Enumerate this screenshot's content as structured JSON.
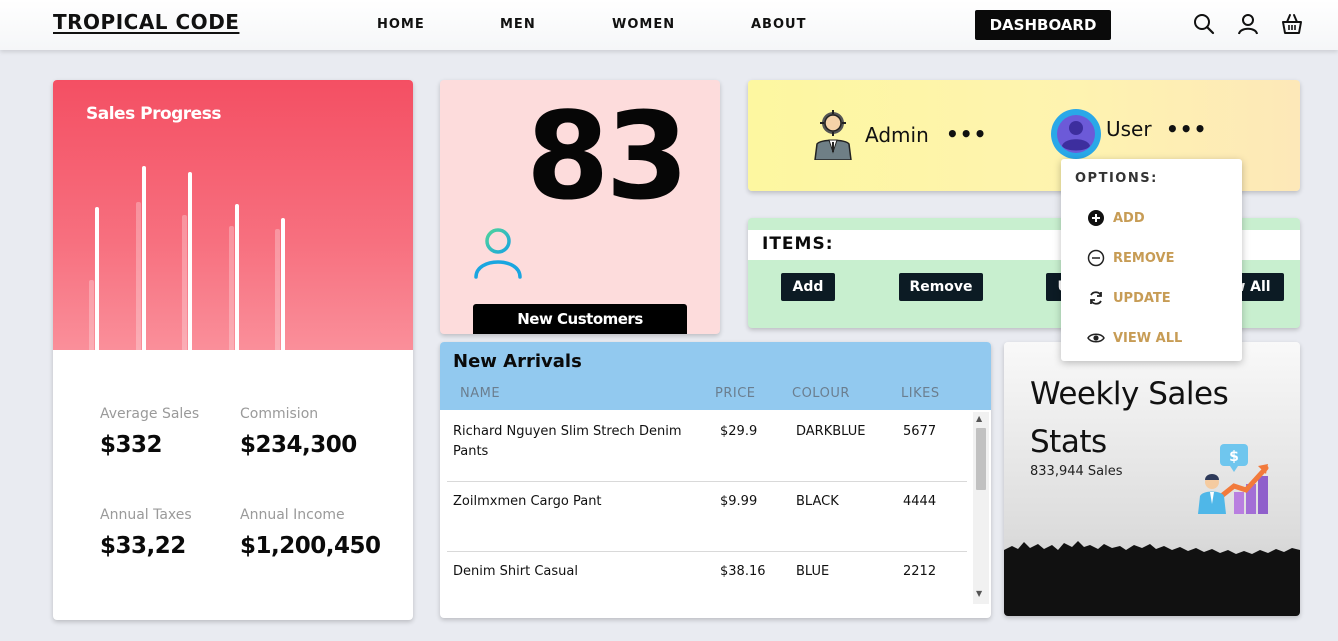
{
  "header": {
    "brand": "TROPICAL CODE",
    "nav": [
      "HOME",
      "MEN",
      "WOMEN",
      "ABOUT"
    ],
    "dashboard_label": "DASHBOARD",
    "icons": [
      "search-icon",
      "user-icon",
      "cart-icon"
    ]
  },
  "sales_progress": {
    "title": "Sales Progress",
    "bar_levels": [
      0.26,
      0.53,
      0.55,
      0.68,
      0.5,
      0.66,
      0.46,
      0.54,
      0.45,
      0.49
    ],
    "stats": [
      {
        "label": "Average Sales",
        "value": "$332"
      },
      {
        "label": "Commision",
        "value": "$234,300"
      },
      {
        "label": "Annual Taxes",
        "value": "$33,22"
      },
      {
        "label": "Annual Income",
        "value": "$1,200,450"
      }
    ]
  },
  "customers": {
    "count": "83",
    "button_label": "New Customers"
  },
  "roles": {
    "admin_label": "Admin",
    "user_label": "User",
    "more": "•••"
  },
  "items": {
    "title": "ITEMS:",
    "buttons": [
      "Add",
      "Remove",
      "Update",
      "View All"
    ]
  },
  "options": {
    "title": "OPTIONS:",
    "items": [
      {
        "label": "ADD",
        "icon": "plus-circle-icon"
      },
      {
        "label": "REMOVE",
        "icon": "minus-circle-icon"
      },
      {
        "label": "UPDATE",
        "icon": "refresh-icon"
      },
      {
        "label": "VIEW ALL",
        "icon": "eye-icon"
      }
    ]
  },
  "arrivals": {
    "title": "New Arrivals",
    "columns": [
      "NAME",
      "PRICE",
      "COLOUR",
      "LIKES"
    ],
    "rows": [
      {
        "name": "Richard Nguyen Slim Strech Denim Pants",
        "price": "$29.9",
        "colour": "DARKBLUE",
        "likes": "5677"
      },
      {
        "name": "Zoilmxmen Cargo Pant",
        "price": "$9.99",
        "colour": "BLACK",
        "likes": "4444"
      },
      {
        "name": "Denim Shirt Casual",
        "price": "$38.16",
        "colour": "BLUE",
        "likes": "2212"
      }
    ]
  },
  "weekly": {
    "title": "Weekly Sales Stats",
    "subtitle": "833,944 Sales"
  },
  "colors": {
    "accent_red": "#f44f63",
    "customers_bg": "#fddcdc",
    "roles_bg": "#fdf7a0",
    "items_bg": "#c8efcf",
    "arrivals_head": "#92c9ef",
    "option_text": "#c79c55"
  }
}
